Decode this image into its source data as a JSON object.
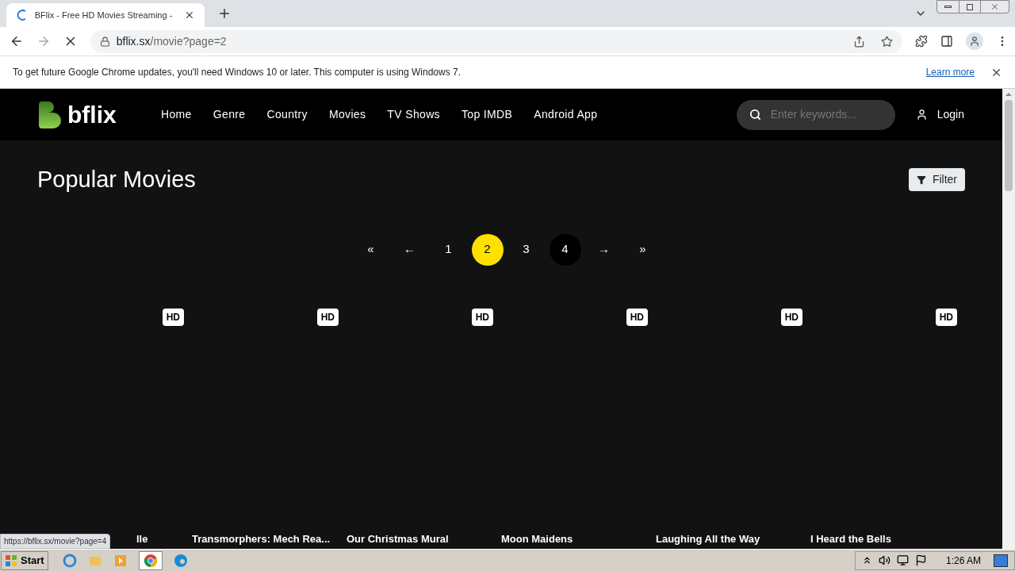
{
  "browser": {
    "tab": {
      "title": "BFlix - Free HD Movies Streaming -"
    },
    "url_host": "bflix.sx",
    "url_path": "/movie?page=2",
    "infobar": {
      "message": "To get future Google Chrome updates, you'll need Windows 10 or later. This computer is using Windows 7.",
      "link": "Learn more"
    }
  },
  "site": {
    "logo": "bflix",
    "nav": [
      "Home",
      "Genre",
      "Country",
      "Movies",
      "TV Shows",
      "Top IMDB",
      "Android App"
    ],
    "search": {
      "placeholder": "Enter keywords..."
    },
    "login": "Login"
  },
  "heading": "Popular Movies",
  "filter": "Filter",
  "pagination": [
    {
      "label": "«",
      "selected": false,
      "hovered": false
    },
    {
      "label": "←",
      "selected": false,
      "hovered": false
    },
    {
      "label": "1",
      "selected": false,
      "hovered": false
    },
    {
      "label": "2",
      "selected": true,
      "hovered": false
    },
    {
      "label": "3",
      "selected": false,
      "hovered": false
    },
    {
      "label": "4",
      "selected": false,
      "hovered": true
    },
    {
      "label": "→",
      "selected": false,
      "hovered": false
    },
    {
      "label": "»",
      "selected": false,
      "hovered": false
    }
  ],
  "movies": [
    {
      "badge": "HD",
      "title": "lle"
    },
    {
      "badge": "HD",
      "title": "Transmorphers: Mech Rea..."
    },
    {
      "badge": "HD",
      "title": "Our Christmas Mural"
    },
    {
      "badge": "HD",
      "title": "Moon Maidens"
    },
    {
      "badge": "HD",
      "title": "Laughing All the Way"
    },
    {
      "badge": "HD",
      "title": "I Heard the Bells"
    }
  ],
  "status_url": "https://bflix.sx/movie?page=4",
  "taskbar": {
    "start": "Start",
    "time": "1:26 AM"
  }
}
